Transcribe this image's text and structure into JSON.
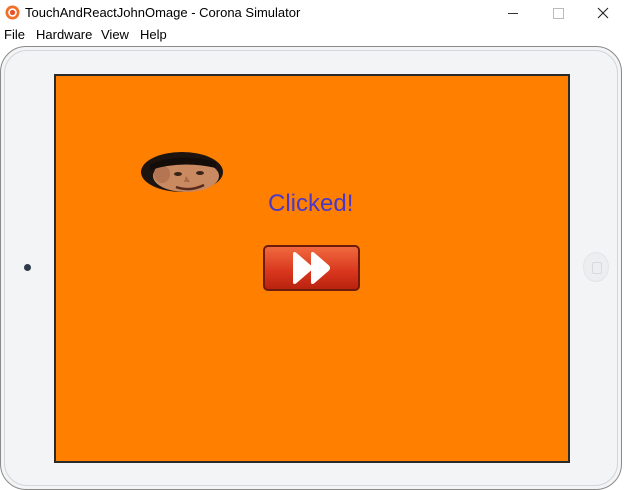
{
  "window": {
    "title": "TouchAndReactJohnOmage - Corona Simulator",
    "minimize_glyph": "—",
    "maximize_glyph": "☐",
    "close_glyph": "✕"
  },
  "menu": {
    "items": [
      {
        "label": "File"
      },
      {
        "label": "Hardware"
      },
      {
        "label": "View"
      },
      {
        "label": "Help"
      }
    ]
  },
  "screen": {
    "background_color": "#ff8000",
    "label_text": "Clicked!",
    "label_color": "#4b38c8",
    "button_icon": "fast-forward-icon",
    "face_image": "face-icon"
  }
}
